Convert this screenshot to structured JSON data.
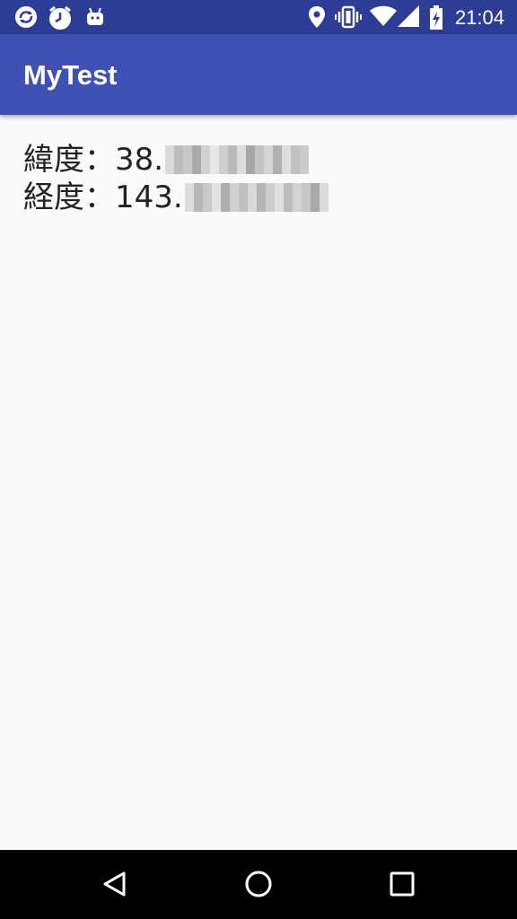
{
  "status_bar": {
    "time": "21:04",
    "left_icons": [
      "sync-icon",
      "alarm-icon",
      "android-icon"
    ],
    "right_icons": [
      "location-icon",
      "vibrate-icon",
      "wifi-icon",
      "signal-icon",
      "battery-icon"
    ]
  },
  "app_bar": {
    "title": "MyTest"
  },
  "content": {
    "latitude_text": "緯度：38.",
    "longitude_text": "経度：143."
  },
  "nav_bar": {
    "buttons": [
      "back-icon",
      "home-icon",
      "recents-icon"
    ]
  },
  "colors": {
    "status_bar": "#2d3c94",
    "app_bar": "#3f51b5",
    "background": "#fafafa",
    "nav_bar": "#000000"
  }
}
